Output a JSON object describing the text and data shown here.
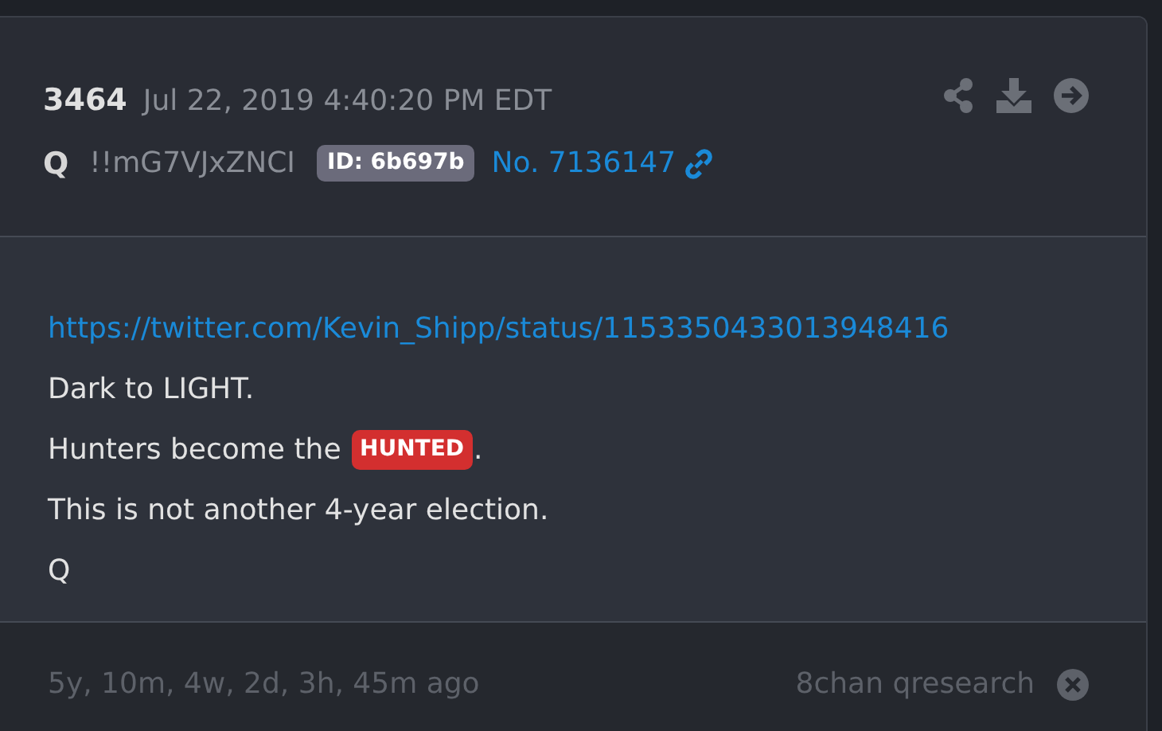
{
  "post": {
    "number": "3464",
    "date": "Jul 22, 2019 4:40:20 PM EDT",
    "author": "Q",
    "tripcode": "!!mG7VJxZNCI",
    "id_badge": "ID: 6b697b",
    "post_no": "No. 7136147",
    "body": [
      {
        "kind": "link",
        "text": "https://twitter.com/Kevin_Shipp/status/1153350433013948416"
      },
      {
        "kind": "text",
        "text": "Dark to LIGHT."
      },
      {
        "kind": "mixed",
        "parts": [
          {
            "kind": "text",
            "text": "Hunters become the "
          },
          {
            "kind": "tag",
            "text": "HUNTED"
          },
          {
            "kind": "text",
            "text": "."
          }
        ]
      },
      {
        "kind": "text",
        "text": "This is not another 4-year election."
      },
      {
        "kind": "text",
        "text": "Q"
      }
    ],
    "footer": {
      "ago": "5y, 10m, 4w, 2d, 3h, 45m ago",
      "source": "8chan qresearch"
    }
  }
}
